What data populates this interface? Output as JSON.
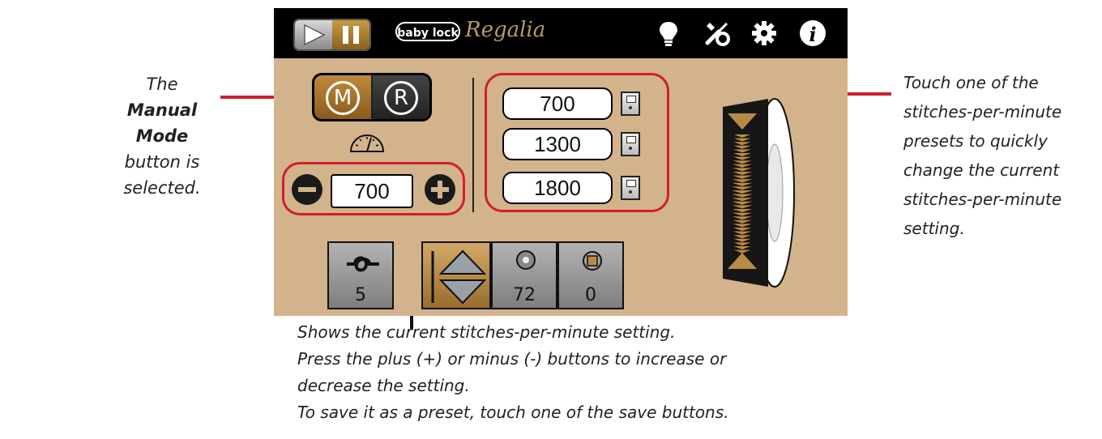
{
  "app": {
    "brand_oval": "baby lock",
    "brand_script": "Regalia"
  },
  "topbar": {
    "icons": [
      "play-icon",
      "pause-icon",
      "lightbulb-icon",
      "tools-icon",
      "gear-icon",
      "info-icon"
    ]
  },
  "mode": {
    "manual": "M",
    "regular": "R",
    "selected": "M"
  },
  "spm": {
    "current": "700"
  },
  "presets": [
    {
      "value": "700"
    },
    {
      "value": "1300"
    },
    {
      "value": "1800"
    }
  ],
  "status": {
    "tie_off": "5",
    "bobbin": "72",
    "thread": "0"
  },
  "annotations": {
    "left_prefix": "The ",
    "left_bold": "Manual Mode",
    "left_suffix": "button is selected.",
    "right": "Touch one of the stitches-per-minute presets to quickly change the current stitches-per-minute setting.",
    "bottom": [
      "Shows the current stitches-per-minute setting.",
      "Press the plus (+) or minus (-) buttons to increase or",
      "decrease the setting.",
      "To save it as a preset, touch one of the save buttons."
    ]
  },
  "colors": {
    "panel": "#d2b38c",
    "accent_red": "#d11e2c",
    "gold": "#c08a3e"
  }
}
